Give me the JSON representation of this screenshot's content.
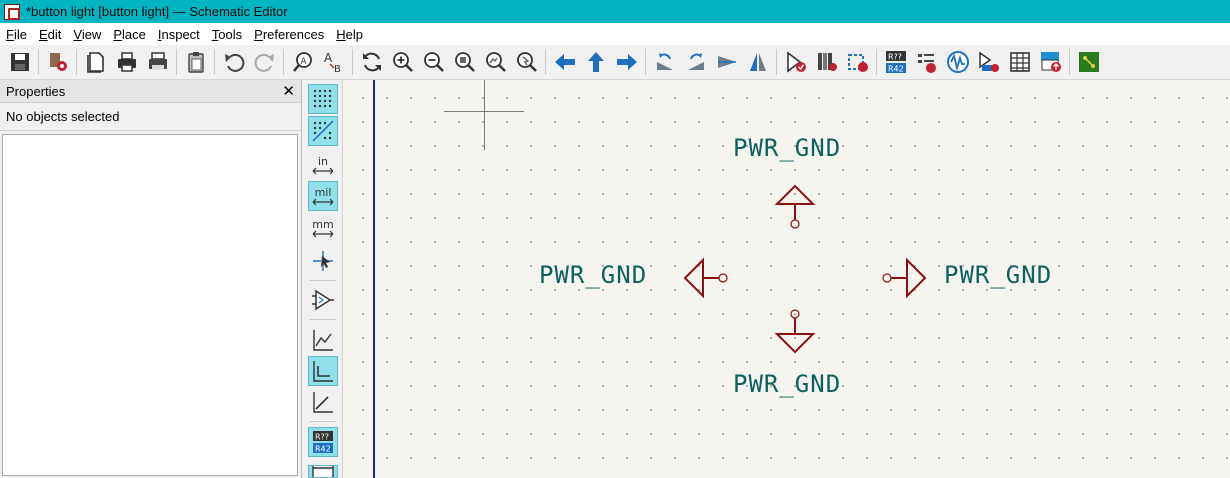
{
  "window": {
    "title": "*button light [button light] — Schematic Editor"
  },
  "menu": {
    "items": [
      {
        "key": "F",
        "rest": "ile"
      },
      {
        "key": "E",
        "rest": "dit"
      },
      {
        "key": "V",
        "rest": "iew"
      },
      {
        "key": "P",
        "rest": "lace"
      },
      {
        "key": "I",
        "rest": "nspect"
      },
      {
        "key": "T",
        "rest": "ools"
      },
      {
        "key": "P",
        "rest": "references"
      },
      {
        "key": "H",
        "rest": "elp"
      }
    ]
  },
  "toolbar": {
    "icons": [
      "save-icon",
      "schematic-setup-icon",
      "page-settings-icon",
      "print-icon",
      "plot-icon",
      "paste-icon",
      "undo-icon",
      "redo-icon",
      "find-icon",
      "find-replace-icon",
      "refresh-icon",
      "zoom-in-icon",
      "zoom-out-icon",
      "zoom-fit-icon",
      "zoom-objects-icon",
      "zoom-selection-icon",
      "navigate-back-icon",
      "navigate-up-icon",
      "navigate-forward-icon",
      "rotate-ccw-icon",
      "rotate-cw-icon",
      "mirror-v-icon",
      "mirror-h-icon",
      "symbol-editor-icon",
      "symbol-browser-icon",
      "footprint-assign-icon",
      "annotate-icon",
      "erc-icon",
      "simulator-icon",
      "assign-footprints-icon",
      "bom-table-icon",
      "generate-bom-icon",
      "pcb-editor-icon"
    ]
  },
  "properties_panel": {
    "title": "Properties",
    "status": "No objects selected"
  },
  "left_toolbar": {
    "in_label": "in",
    "mil_label": "mil",
    "mm_label": "mm",
    "annotate_top": "R??",
    "annotate_bottom": "R42"
  },
  "annotate_icon_text": {
    "top": "R??",
    "bottom": "R42"
  },
  "schematic": {
    "labels": {
      "top": "PWR_GND",
      "left": "PWR_GND",
      "right": "PWR_GND",
      "bottom": "PWR_GND"
    },
    "colors": {
      "symbol": "#8b1010",
      "label": "#0c6060",
      "sheet_border": "#1c2a8f",
      "background": "#f5f4ef"
    }
  }
}
